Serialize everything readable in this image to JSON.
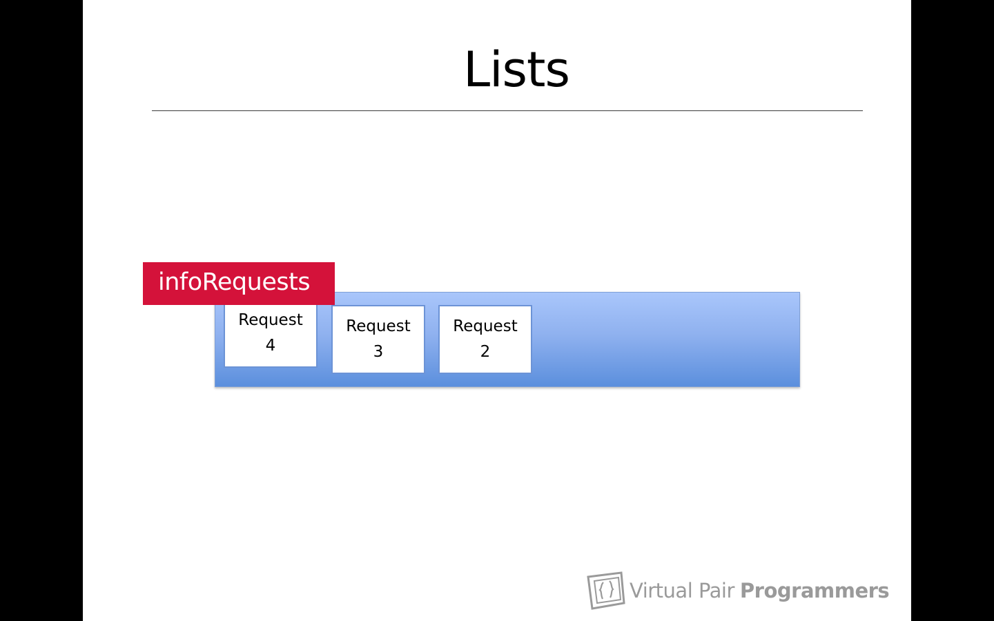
{
  "slide": {
    "title": "Lists"
  },
  "diagram": {
    "list_label": "infoRequests",
    "items": [
      {
        "word": "Request",
        "number": "4"
      },
      {
        "word": "Request",
        "number": "3"
      },
      {
        "word": "Request",
        "number": "2"
      }
    ]
  },
  "logo": {
    "light_text": "Virtual Pair",
    "bold_text": "Programmers",
    "color": "#9a9a9a"
  },
  "colors": {
    "label_background": "#d4123a",
    "list_bar": "#8fb1ef",
    "box_border": "#6c93d6"
  }
}
